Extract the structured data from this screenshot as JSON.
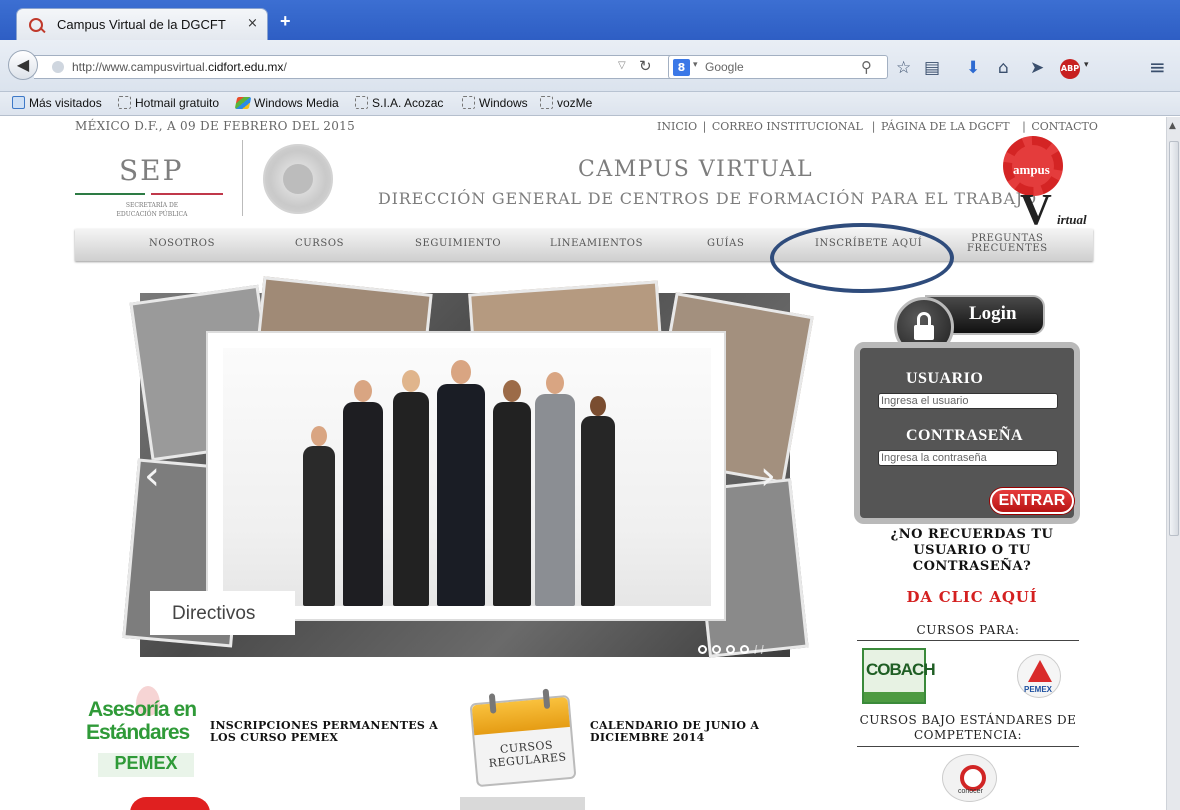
{
  "browser": {
    "tab_title": "Campus Virtual de la DGCFT",
    "tab_close": "×",
    "new_tab": "+",
    "url_prefix": "http://www.campusvirtual.",
    "url_domain": "cidfort.edu.mx",
    "url_suffix": "/",
    "search_engine": "Google",
    "search_engine_badge": "8",
    "bookmarks": [
      {
        "label": "Más visitados"
      },
      {
        "label": "Hotmail gratuito"
      },
      {
        "label": "Windows Media"
      },
      {
        "label": "S.I.A. Acozac"
      },
      {
        "label": "Windows"
      },
      {
        "label": "vozMe"
      }
    ],
    "abp_badge": "ABP"
  },
  "page": {
    "date": "MÉXICO D.F., A 09 DE FEBRERO DEL 2015",
    "toplinks": [
      "INICIO",
      "CORREO INSTITUCIONAL",
      "PÁGINA DE LA DGCFT",
      "CONTACTO"
    ],
    "sep": {
      "acronym": "SEP",
      "subtitle_line1": "SECRETARÍA DE",
      "subtitle_line2": "EDUCACIÓN PÚBLICA"
    },
    "title": "CAMPUS VIRTUAL",
    "subtitle": "DIRECCIÓN GENERAL DE CENTROS DE FORMACIÓN PARA EL TRABAJO",
    "logo": {
      "ampus": "ampus",
      "v": "V",
      "irtual": "irtual"
    },
    "menu": [
      {
        "label": "NOSOTROS"
      },
      {
        "label": "CURSOS"
      },
      {
        "label": "SEGUIMIENTO"
      },
      {
        "label": "LINEAMIENTOS"
      },
      {
        "label": "GUÍAS"
      },
      {
        "label": "INSCRÍBETE AQUÍ"
      },
      {
        "label_line1": "PREGUNTAS",
        "label_line2": "FRECUENTES"
      }
    ],
    "slider": {
      "caption": "Directivos",
      "prev": "‹",
      "next": "›",
      "slides_total": 4,
      "slide_active": 1
    },
    "login": {
      "title": "Login",
      "user_label": "USUARIO",
      "user_placeholder": "Ingresa el usuario",
      "pass_label": "CONTRASEÑA",
      "pass_placeholder": "Ingresa la contraseña",
      "submit": "ENTRAR",
      "forgot_line1": "¿NO RECUERDAS TU",
      "forgot_line2": "USUARIO O TU",
      "forgot_line3": "CONTRASEÑA?",
      "click_here": "DA CLIC AQUÍ"
    },
    "sidebar": {
      "cursos_para": "CURSOS PARA:",
      "cobach": "COBACH",
      "pemex": "PEMEX",
      "estandares_line1": "CURSOS BAJO ESTÁNDARES DE",
      "estandares_line2": "COMPETENCIA:",
      "conocer": "conocer"
    },
    "news": {
      "asesoria_line1": "Asesoría en",
      "asesoria_line2": "Estándares",
      "asesoria_line3": "PEMEX",
      "item1": "INSCRIPCIONES PERMANENTES A LOS CURSO PEMEX",
      "cal_line1": "CURSOS",
      "cal_line2": "REGULARES",
      "item2": "CALENDARIO DE JUNIO A DICIEMBRE 2014"
    }
  },
  "colors": {
    "accent_red": "#d42020",
    "annotation_ellipse": "#2f4c7c",
    "pemex_green": "#2f9a38"
  }
}
